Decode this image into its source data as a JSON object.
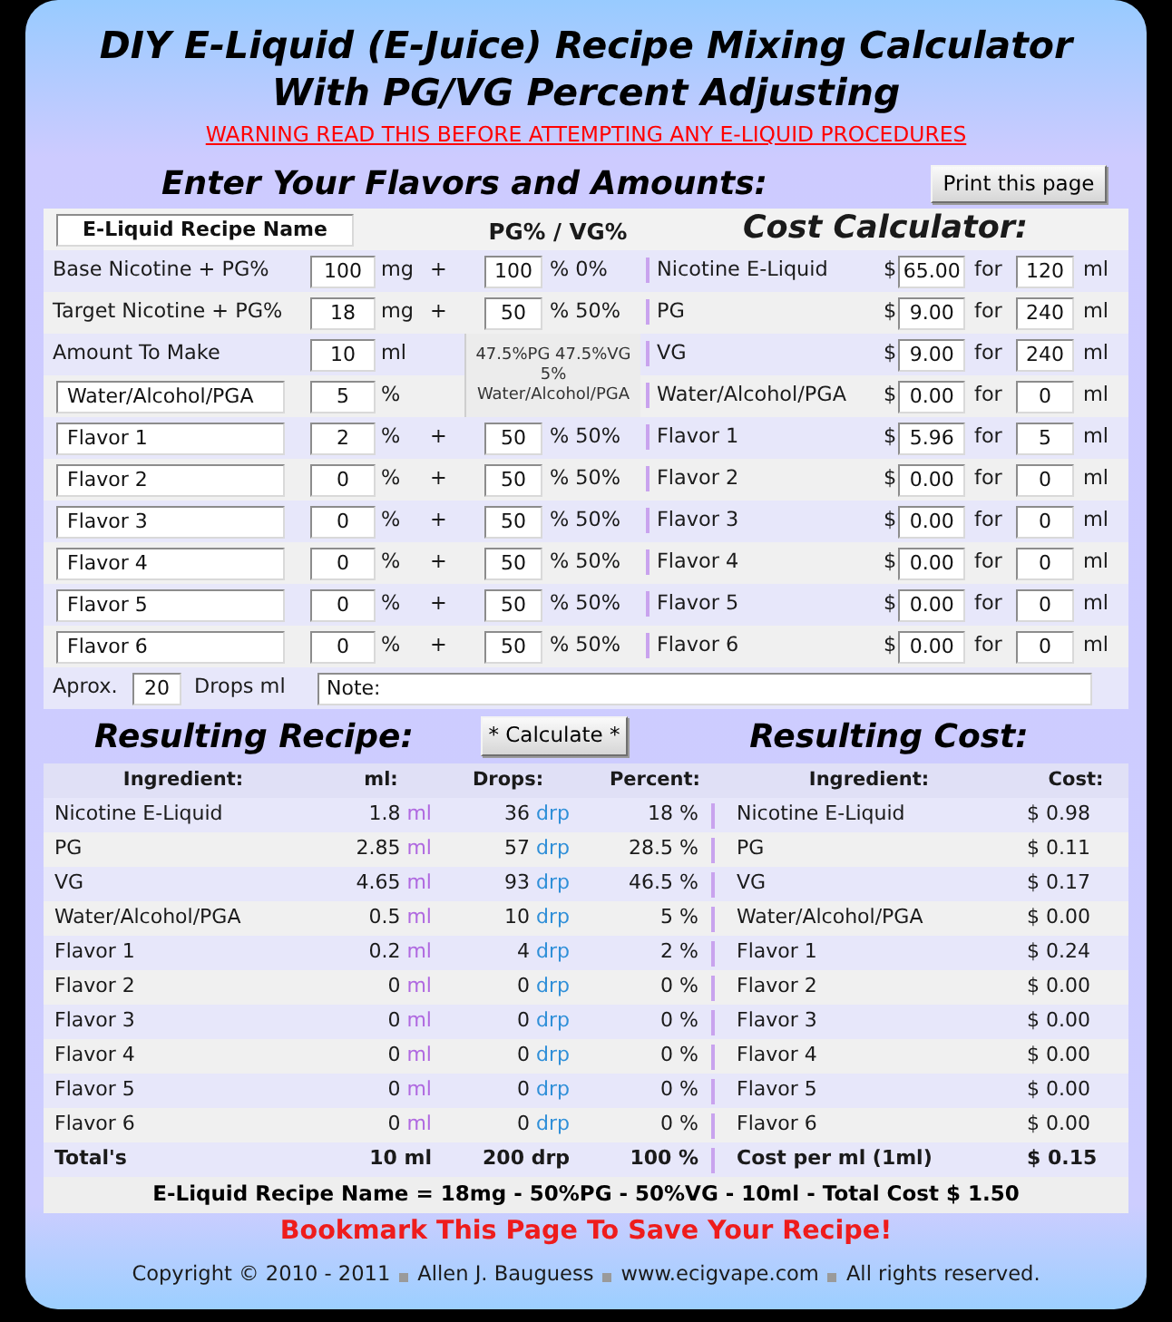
{
  "title_lines": [
    "DIY E-Liquid (E-Juice) Recipe Mixing Calculator",
    "With PG/VG Percent Adjusting"
  ],
  "warning_link": "WARNING READ THIS BEFORE ATTEMPTING ANY E-LIQUID PROCEDURES",
  "entry": {
    "heading": "Enter Your Flavors and Amounts:",
    "print_button": "Print this page",
    "recipe_name": "E-Liquid Recipe Name",
    "ratio_heading": "PG% / VG%",
    "cost_heading": "Cost Calculator:",
    "mix_note": [
      "47.5%PG 47.5%VG",
      "5%",
      "Water/Alcohol/PGA"
    ],
    "rows": [
      {
        "kind": "ratio",
        "label": {
          "kind": "text",
          "text": "Base Nicotine + PG%"
        },
        "amount": "100",
        "unit": "mg",
        "plus": "+",
        "pg": "100",
        "vg": "% 0%",
        "cost": {
          "item": "Nicotine E-Liquid",
          "currency": "$",
          "price": "65.00",
          "for": "for",
          "amount": "120",
          "unit": "ml"
        }
      },
      {
        "kind": "ratio",
        "label": {
          "kind": "text",
          "text": "Target Nicotine + PG%"
        },
        "amount": "18",
        "unit": "mg",
        "plus": "+",
        "pg": "50",
        "vg": "% 50%",
        "cost": {
          "item": "PG",
          "currency": "$",
          "price": "9.00",
          "for": "for",
          "amount": "240",
          "unit": "ml"
        }
      },
      {
        "kind": "plain",
        "label": {
          "kind": "text",
          "text": "Amount To Make"
        },
        "amount": "10",
        "unit": "ml",
        "cost": {
          "item": "VG",
          "currency": "$",
          "price": "9.00",
          "for": "for",
          "amount": "240",
          "unit": "ml"
        }
      },
      {
        "kind": "plain",
        "label": {
          "kind": "field",
          "text": "Water/Alcohol/PGA"
        },
        "amount": "5",
        "unit": "%",
        "cost": {
          "item": "Water/Alcohol/PGA",
          "currency": "$",
          "price": "0.00",
          "for": "for",
          "amount": "0",
          "unit": "ml"
        }
      },
      {
        "kind": "ratio",
        "label": {
          "kind": "field",
          "text": "Flavor 1"
        },
        "amount": "2",
        "unit": "%",
        "plus": "+",
        "pg": "50",
        "vg": "% 50%",
        "cost": {
          "item": "Flavor 1",
          "currency": "$",
          "price": "5.96",
          "for": "for",
          "amount": "5",
          "unit": "ml"
        }
      },
      {
        "kind": "ratio",
        "label": {
          "kind": "field",
          "text": "Flavor 2"
        },
        "amount": "0",
        "unit": "%",
        "plus": "+",
        "pg": "50",
        "vg": "% 50%",
        "cost": {
          "item": "Flavor 2",
          "currency": "$",
          "price": "0.00",
          "for": "for",
          "amount": "0",
          "unit": "ml"
        }
      },
      {
        "kind": "ratio",
        "label": {
          "kind": "field",
          "text": "Flavor 3"
        },
        "amount": "0",
        "unit": "%",
        "plus": "+",
        "pg": "50",
        "vg": "% 50%",
        "cost": {
          "item": "Flavor 3",
          "currency": "$",
          "price": "0.00",
          "for": "for",
          "amount": "0",
          "unit": "ml"
        }
      },
      {
        "kind": "ratio",
        "label": {
          "kind": "field",
          "text": "Flavor 4"
        },
        "amount": "0",
        "unit": "%",
        "plus": "+",
        "pg": "50",
        "vg": "% 50%",
        "cost": {
          "item": "Flavor 4",
          "currency": "$",
          "price": "0.00",
          "for": "for",
          "amount": "0",
          "unit": "ml"
        }
      },
      {
        "kind": "ratio",
        "label": {
          "kind": "field",
          "text": "Flavor 5"
        },
        "amount": "0",
        "unit": "%",
        "plus": "+",
        "pg": "50",
        "vg": "% 50%",
        "cost": {
          "item": "Flavor 5",
          "currency": "$",
          "price": "0.00",
          "for": "for",
          "amount": "0",
          "unit": "ml"
        }
      },
      {
        "kind": "ratio",
        "label": {
          "kind": "field",
          "text": "Flavor 6"
        },
        "amount": "0",
        "unit": "%",
        "plus": "+",
        "pg": "50",
        "vg": "% 50%",
        "cost": {
          "item": "Flavor 6",
          "currency": "$",
          "price": "0.00",
          "for": "for",
          "amount": "0",
          "unit": "ml"
        }
      }
    ],
    "drops": {
      "label": "Aprox.",
      "value": "20",
      "unit": "Drops ml"
    },
    "note": {
      "value": "Note:"
    }
  },
  "results": {
    "recipe_heading": "Resulting Recipe:",
    "calculate_button": "* Calculate *",
    "cost_heading": "Resulting Cost:",
    "columns": [
      "Ingredient:",
      "ml:",
      "Drops:",
      "Percent:"
    ],
    "cost_columns": [
      "Ingredient:",
      "Cost:"
    ],
    "rows": [
      {
        "ingredient": "Nicotine E-Liquid",
        "ml": "1.8",
        "ml_unit": "ml",
        "drops": "36",
        "drops_unit": "drp",
        "percent": "18 %",
        "cost_item": "Nicotine E-Liquid",
        "cost": "$ 0.98"
      },
      {
        "ingredient": "PG",
        "ml": "2.85",
        "ml_unit": "ml",
        "drops": "57",
        "drops_unit": "drp",
        "percent": "28.5 %",
        "cost_item": "PG",
        "cost": "$ 0.11"
      },
      {
        "ingredient": "VG",
        "ml": "4.65",
        "ml_unit": "ml",
        "drops": "93",
        "drops_unit": "drp",
        "percent": "46.5 %",
        "cost_item": "VG",
        "cost": "$ 0.17"
      },
      {
        "ingredient": "Water/Alcohol/PGA",
        "ml": "0.5",
        "ml_unit": "ml",
        "drops": "10",
        "drops_unit": "drp",
        "percent": "5 %",
        "cost_item": "Water/Alcohol/PGA",
        "cost": "$ 0.00"
      },
      {
        "ingredient": "Flavor 1",
        "ml": "0.2",
        "ml_unit": "ml",
        "drops": "4",
        "drops_unit": "drp",
        "percent": "2 %",
        "cost_item": "Flavor 1",
        "cost": "$ 0.24"
      },
      {
        "ingredient": "Flavor 2",
        "ml": "0",
        "ml_unit": "ml",
        "drops": "0",
        "drops_unit": "drp",
        "percent": "0 %",
        "cost_item": "Flavor 2",
        "cost": "$ 0.00"
      },
      {
        "ingredient": "Flavor 3",
        "ml": "0",
        "ml_unit": "ml",
        "drops": "0",
        "drops_unit": "drp",
        "percent": "0 %",
        "cost_item": "Flavor 3",
        "cost": "$ 0.00"
      },
      {
        "ingredient": "Flavor 4",
        "ml": "0",
        "ml_unit": "ml",
        "drops": "0",
        "drops_unit": "drp",
        "percent": "0 %",
        "cost_item": "Flavor 4",
        "cost": "$ 0.00"
      },
      {
        "ingredient": "Flavor 5",
        "ml": "0",
        "ml_unit": "ml",
        "drops": "0",
        "drops_unit": "drp",
        "percent": "0 %",
        "cost_item": "Flavor 5",
        "cost": "$ 0.00"
      },
      {
        "ingredient": "Flavor 6",
        "ml": "0",
        "ml_unit": "ml",
        "drops": "0",
        "drops_unit": "drp",
        "percent": "0 %",
        "cost_item": "Flavor 6",
        "cost": "$ 0.00"
      }
    ],
    "totals": {
      "label": "Total's",
      "ml": "10 ml",
      "drops": "200 drp",
      "percent": "100 %",
      "cost_label": "Cost per ml (1ml)",
      "cost": "$ 0.15"
    }
  },
  "summary": "E-Liquid Recipe Name = 18mg - 50%PG - 50%VG - 10ml - Total Cost $ 1.50",
  "bookmark": "Bookmark This Page To Save Your Recipe!",
  "footer": [
    "Copyright © 2010 - 2011",
    "Allen J. Bauguess",
    "www.ecigvape.com",
    "All rights reserved."
  ]
}
